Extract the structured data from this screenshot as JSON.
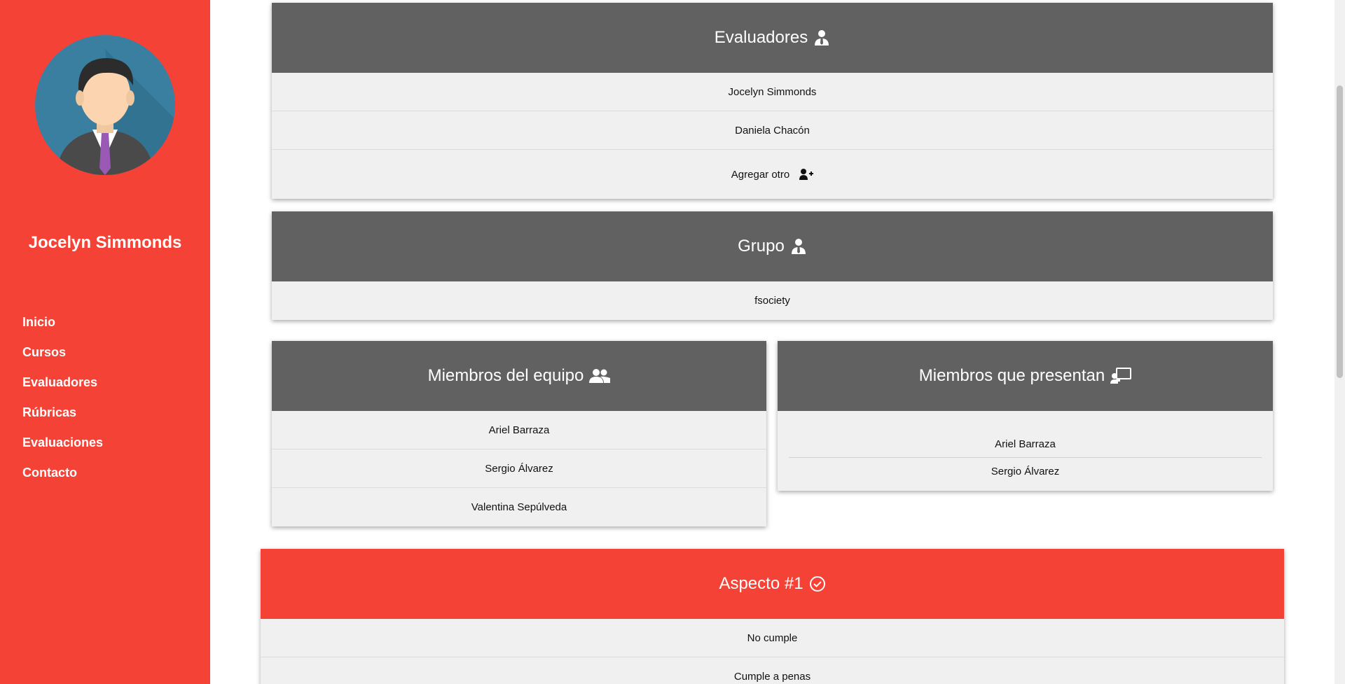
{
  "sidebar": {
    "user_name": "Jocelyn Simmonds",
    "nav": [
      "Inicio",
      "Cursos",
      "Evaluadores",
      "Rúbricas",
      "Evaluaciones",
      "Contacto"
    ]
  },
  "evaluadores": {
    "title": "Evaluadores",
    "items": [
      "Jocelyn Simmonds",
      "Daniela Chacón"
    ],
    "add_label": "Agregar otro"
  },
  "grupo": {
    "title": "Grupo",
    "value": "fsociety"
  },
  "miembros": {
    "title": "Miembros del equipo",
    "items": [
      "Ariel Barraza",
      "Sergio Álvarez",
      "Valentina Sepúlveda"
    ]
  },
  "presentan": {
    "title": "Miembros que presentan",
    "items": [
      "Ariel Barraza",
      "Sergio Álvarez"
    ]
  },
  "aspecto": {
    "title": "Aspecto #1",
    "options": [
      "No cumple",
      "Cumple a penas"
    ]
  },
  "colors": {
    "accent": "#f44336",
    "header_gray": "#616161",
    "panel_bg": "#f0f0f0"
  },
  "icons": [
    "user-tie-icon",
    "user-plus-icon",
    "users-icon",
    "chalkboard-teacher-icon",
    "check-circle-icon"
  ]
}
